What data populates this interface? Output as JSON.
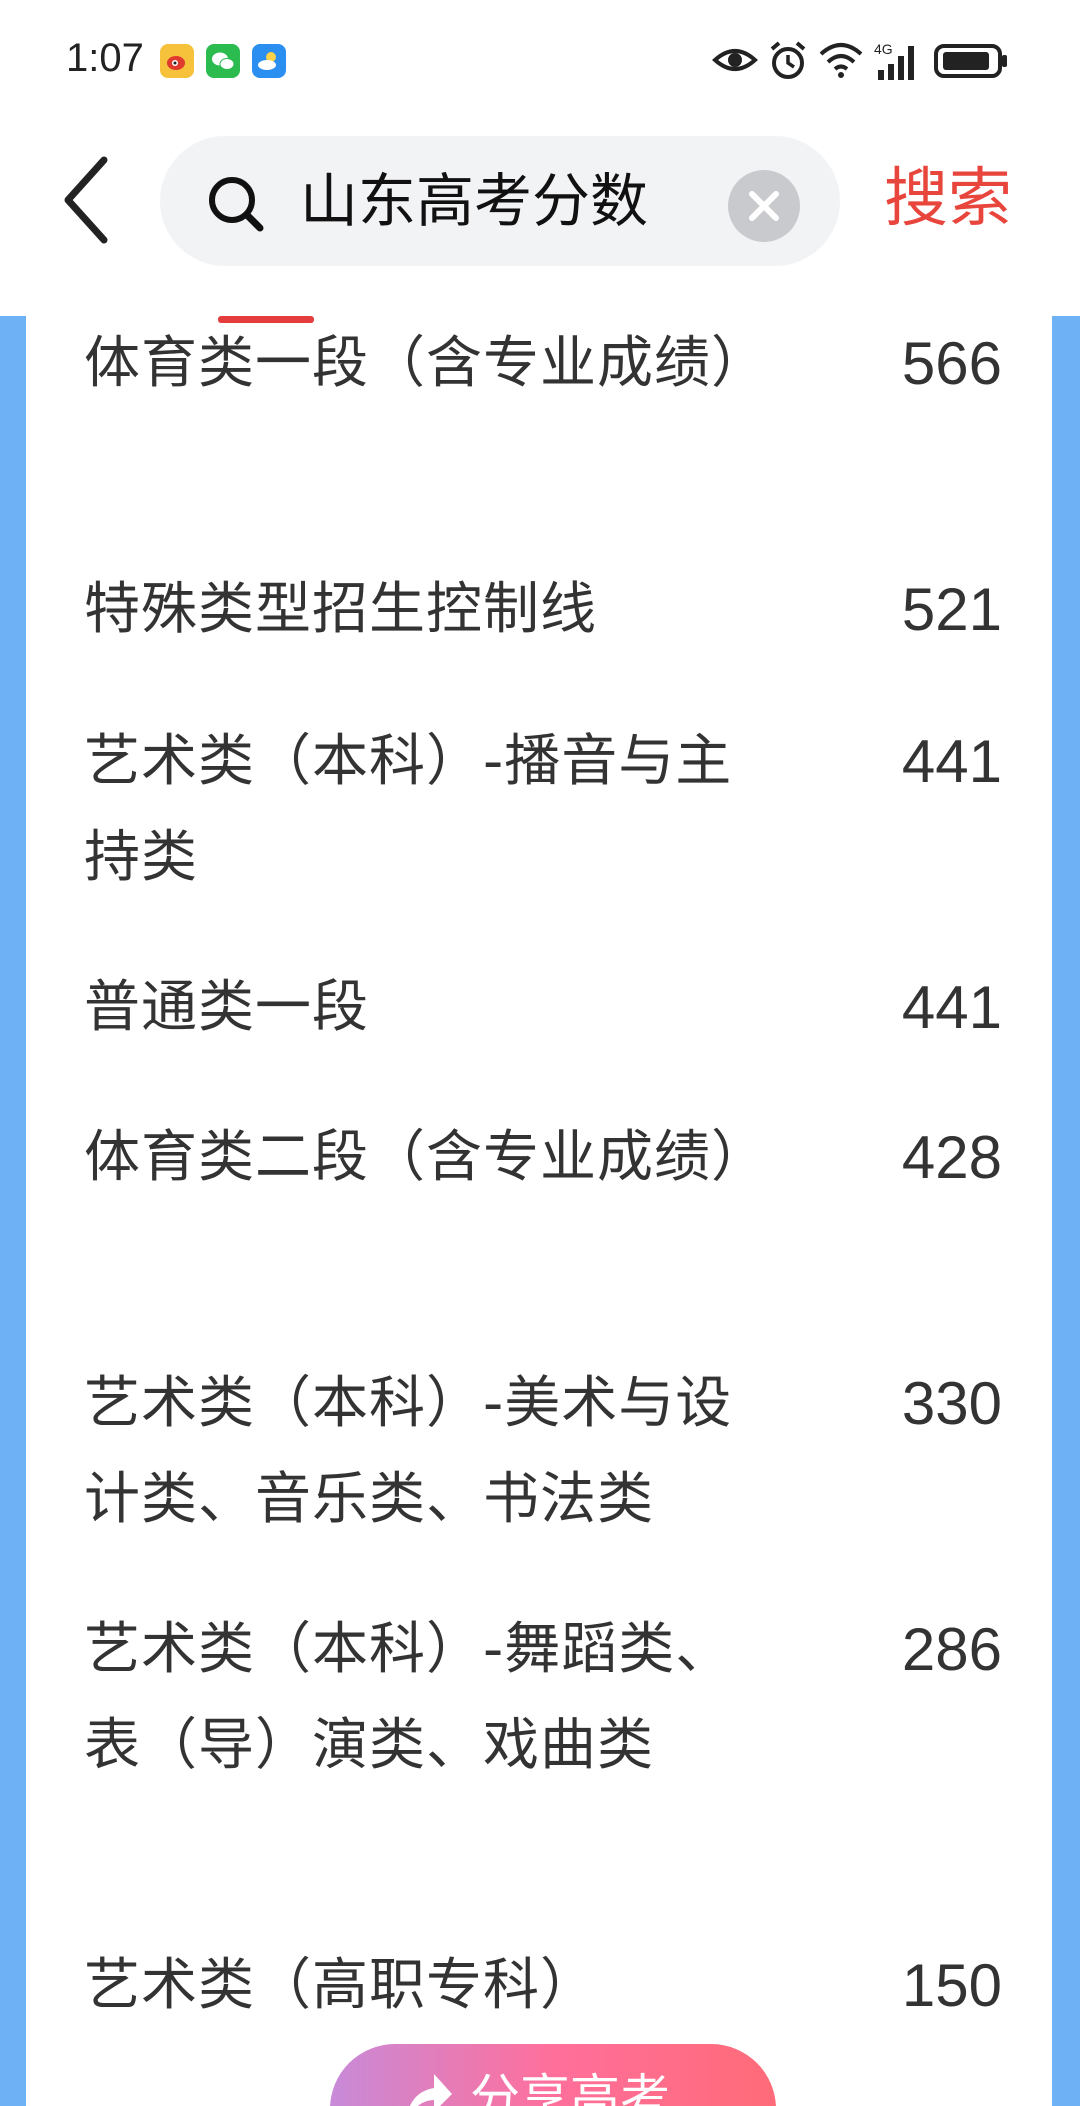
{
  "status_bar": {
    "time": "1:07",
    "notifications": [
      "weibo-icon",
      "wechat-icon",
      "weather-icon"
    ],
    "system_icons": [
      "eye-icon",
      "alarm-icon",
      "wifi-icon",
      "signal-4g-icon",
      "battery-icon"
    ],
    "network_label": "4G"
  },
  "search": {
    "query": "山东高考分数",
    "submit_label": "搜索"
  },
  "colors": {
    "accent_red": "#e8453c",
    "side_blue": "#6fb1f5",
    "share_gradient_start": "#c88ad8",
    "share_gradient_end": "#ff6b78"
  },
  "scores": [
    {
      "label": "体育类一段（含专业成绩）",
      "value": "566"
    },
    {
      "label": "特殊类型招生控制线",
      "value": "521"
    },
    {
      "label": "艺术类（本科）-播音与主持类",
      "value": "441"
    },
    {
      "label": "普通类一段",
      "value": "441"
    },
    {
      "label": "体育类二段（含专业成绩）",
      "value": "428"
    },
    {
      "label": "艺术类（本科）-美术与设计类、音乐类、书法类",
      "value": "330"
    },
    {
      "label": "艺术类（本科）-舞蹈类、表（导）演类、戏曲类",
      "value": "286"
    },
    {
      "label": "艺术类（高职专科）",
      "value": "150"
    }
  ],
  "share": {
    "label": "分享高考"
  }
}
